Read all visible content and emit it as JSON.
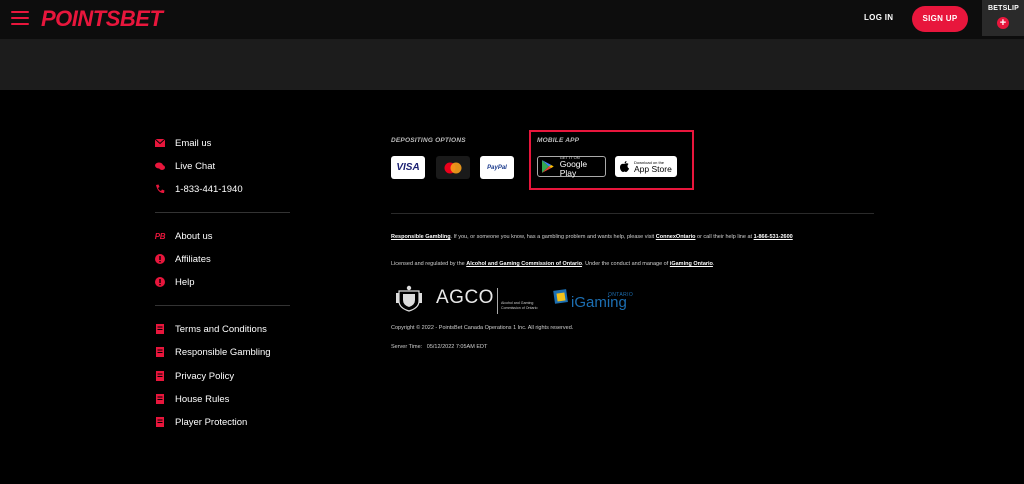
{
  "header": {
    "logo": "POINTSBET",
    "login": "LOG IN",
    "signup": "SIGN UP",
    "betslip": "BETSLIP"
  },
  "contact": [
    {
      "label": "Email us",
      "icon": "envelope-icon"
    },
    {
      "label": "Live Chat",
      "icon": "chat-icon"
    },
    {
      "label": "1-833-441-1940",
      "icon": "phone-icon"
    }
  ],
  "info": [
    {
      "label": "About us",
      "icon": "pb-icon"
    },
    {
      "label": "Affiliates",
      "icon": "info-icon"
    },
    {
      "label": "Help",
      "icon": "info-icon"
    }
  ],
  "legal": [
    {
      "label": "Terms and Conditions",
      "icon": "document-icon"
    },
    {
      "label": "Responsible Gambling",
      "icon": "document-icon"
    },
    {
      "label": "Privacy Policy",
      "icon": "document-icon"
    },
    {
      "label": "House Rules",
      "icon": "document-icon"
    },
    {
      "label": "Player Protection",
      "icon": "document-icon"
    }
  ],
  "depositing": {
    "title": "DEPOSITING OPTIONS",
    "visa": "VISA",
    "paypal": "PayPal"
  },
  "mobile": {
    "title": "MOBILE APP",
    "google_small": "GET IT ON",
    "google_big": "Google Play",
    "apple_small": "Download on the",
    "apple_big": "App Store"
  },
  "footer_text": {
    "rg_link": "Responsible Gambling",
    "rg_text": ". If you, or someone you know, has a gambling problem and wants help, please visit ",
    "connex": "ConnexOntario",
    "rg_text2": " or call their help line at ",
    "helpline": "1-866-531-2600",
    "lic_text": "Licensed and regulated by the ",
    "agco_link": "Alcohol and Gaming Commission of Ontario",
    "lic_text2": ". Under the conduct and manage of ",
    "igo_link": "iGaming Ontario",
    "lic_end": ".",
    "copyright": "Copyright © 2022 - PointsBet Canada Operations 1 Inc. All rights reserved.",
    "server_label": "Server Time:",
    "server_time": "05/12/2022 7:05AM EDT"
  },
  "logos": {
    "agco": "AGCO",
    "agco_sub1": "Alcohol and Gaming",
    "agco_sub2": "Commission of Ontario",
    "igaming": "iGaming",
    "ontario": "ONTARIO"
  },
  "colors": {
    "brand": "#e8163c",
    "background": "#000000",
    "header": "#0d0d0d",
    "grey_band": "#1c1c1c"
  }
}
